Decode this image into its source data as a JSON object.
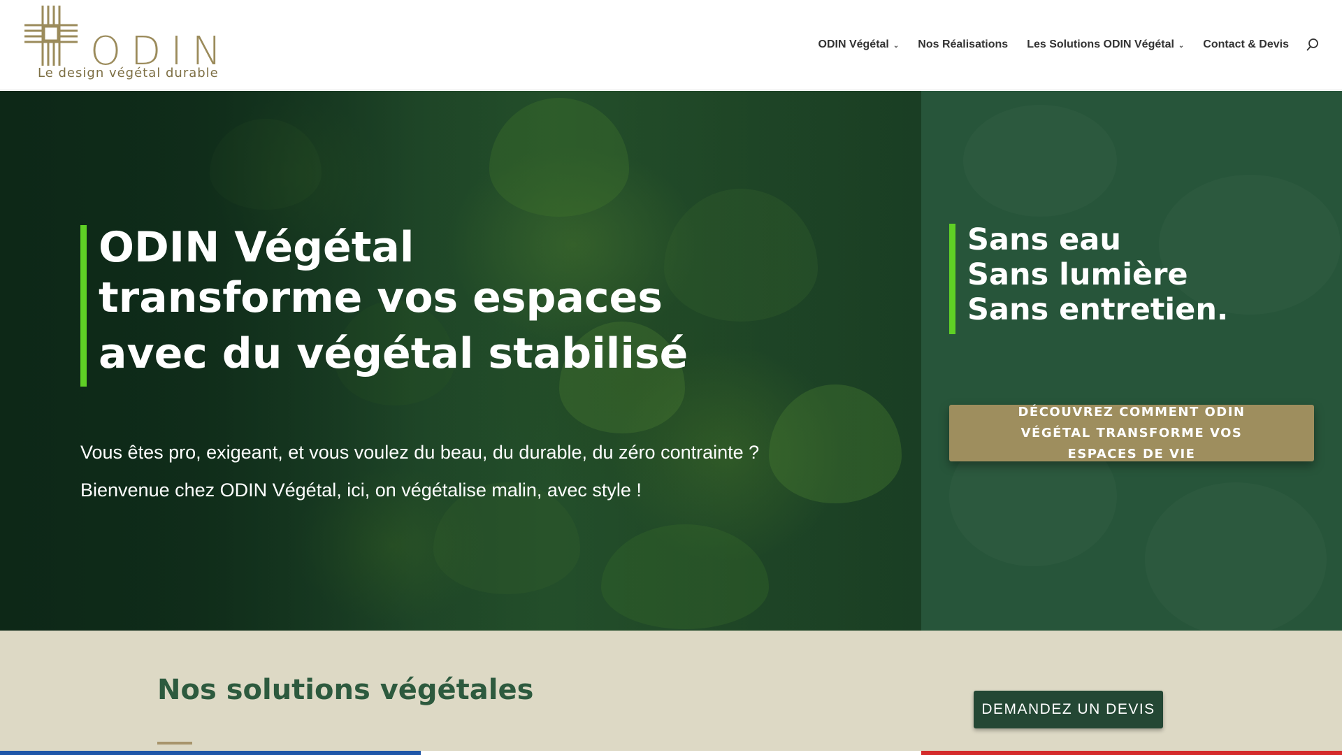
{
  "logo": {
    "wordmark": "ODIN",
    "tagline": "Le design végétal durable",
    "icon": "cross-lattice-icon",
    "color": "#9b8b5b"
  },
  "nav": {
    "items": [
      {
        "label": "ODIN Végétal",
        "has_dropdown": true
      },
      {
        "label": "Nos Réalisations",
        "has_dropdown": false
      },
      {
        "label": "Les Solutions ODIN Végétal",
        "has_dropdown": true
      },
      {
        "label": "Contact & Devis",
        "has_dropdown": false
      }
    ],
    "search_icon": "search-icon"
  },
  "hero": {
    "title_lines": [
      "ODIN Végétal",
      "transforme vos espaces",
      "avec du végétal stabilisé"
    ],
    "paragraphs": [
      "Vous êtes pro, exigeant, et vous voulez du beau, du durable, du zéro contrainte ?",
      "Bienvenue chez ODIN Végétal, ici, on végétalise malin, avec style !"
    ],
    "side_lines": [
      "Sans eau",
      "Sans lumière",
      "Sans entretien."
    ],
    "cta_label": "DÉCOUVREZ COMMENT ODIN VÉGÉTAL TRANSFORME VOS ESPACES DE VIE",
    "accent_color": "#5fd025",
    "side_bg": "#27553a",
    "cta_color": "#9e8e5e"
  },
  "solutions": {
    "title": "Nos solutions végétales",
    "cta_label": "DEMANDEZ UN DEVIS",
    "bg": "#ddd9c5",
    "title_color": "#2d5a3e"
  },
  "flag_colors": [
    "#1f56a8",
    "#ffffff",
    "#d42b2b"
  ]
}
